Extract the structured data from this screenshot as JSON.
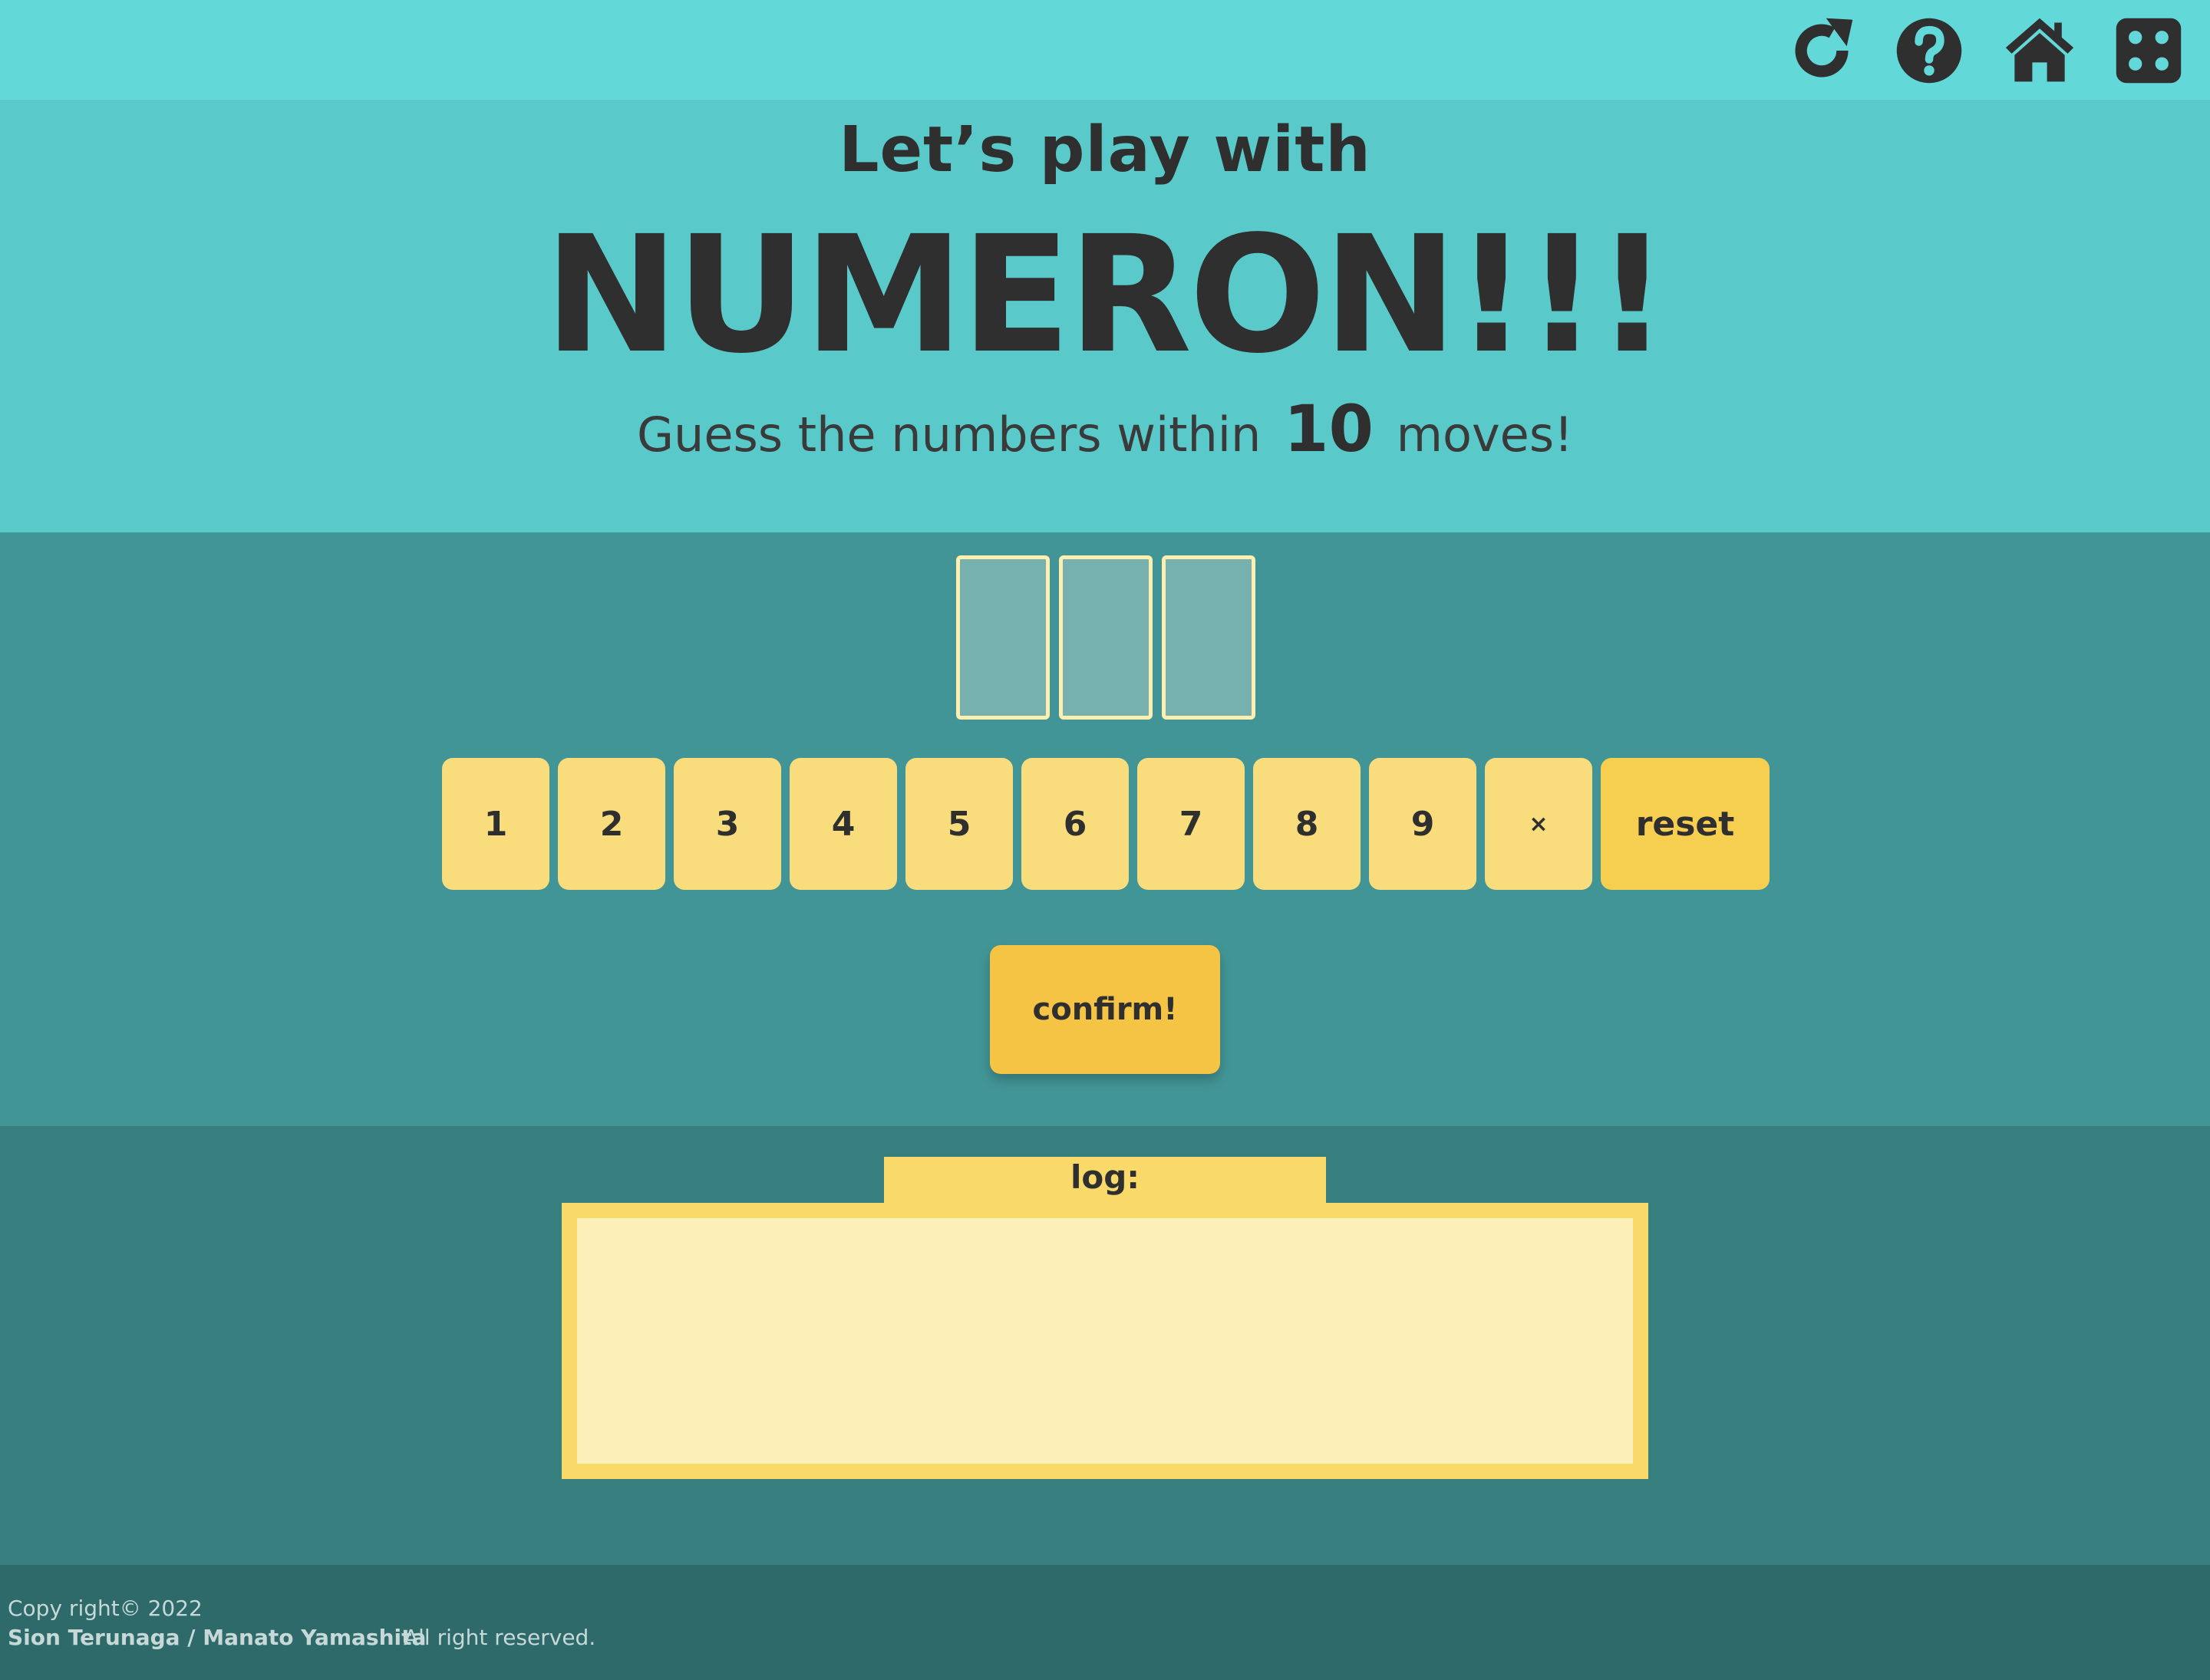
{
  "toolbar": {
    "icons": [
      "refresh-icon",
      "help-icon",
      "home-icon",
      "dice-icon"
    ]
  },
  "hero": {
    "subtitle": "Let’s play with",
    "title": "NUMERON!!!",
    "tag_prefix": "Guess the numbers within",
    "tag_moves": "10",
    "tag_suffix": "moves!"
  },
  "game": {
    "slots": [
      "",
      "",
      ""
    ],
    "keys": [
      "1",
      "2",
      "3",
      "4",
      "5",
      "6",
      "7",
      "8",
      "9",
      "×"
    ],
    "reset_label": "reset",
    "confirm_label": "confirm!"
  },
  "log": {
    "label": "log:",
    "entries": []
  },
  "footer": {
    "copyright": "Copy right© 2022",
    "authors": "Sion Terunaga / Manato Yamashita",
    "rights": "All right reserved."
  },
  "colors": {
    "topbar": "#63d8d8",
    "hero": "#5ac9c9",
    "game": "#429596",
    "log_section": "#377f7e",
    "footer": "#2d6a69",
    "key": "#f9dd7c",
    "accent": "#f6c444"
  }
}
